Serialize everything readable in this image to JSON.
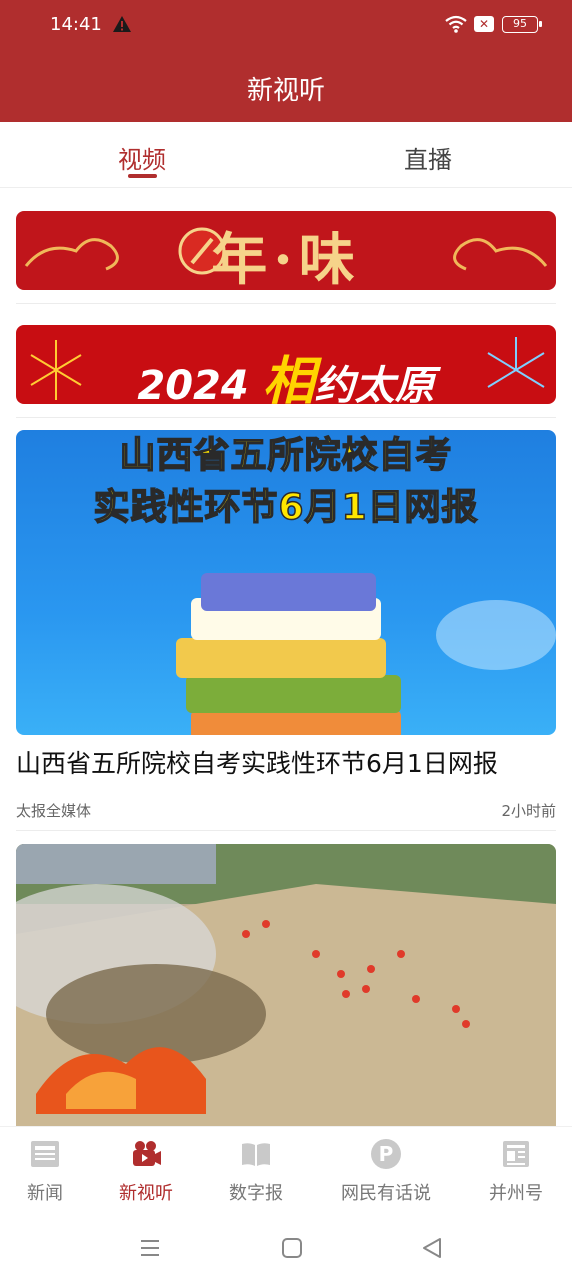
{
  "status_bar": {
    "time": "14:41",
    "battery": "95"
  },
  "header": {
    "title": "新视听"
  },
  "tabs": [
    {
      "label": "视频",
      "active": true
    },
    {
      "label": "直播",
      "active": false
    }
  ],
  "banners": [
    {
      "title": "年·味"
    },
    {
      "year": "2024",
      "accent": "相",
      "rest": "约太原"
    }
  ],
  "news": [
    {
      "thumb_line1": "山西省五所院校自考",
      "thumb_line2": "实践性环节6月1日网报",
      "title": "山西省五所院校自考实践性环节6月1日网报",
      "source": "太报全媒体",
      "time": "2小时前"
    },
    {
      "thumb_icon": "firefighting-drill-photo"
    }
  ],
  "bottom_nav": [
    {
      "label": "新闻",
      "icon": "newspaper-icon",
      "active": false
    },
    {
      "label": "新视听",
      "icon": "video-camera-icon",
      "active": true
    },
    {
      "label": "数字报",
      "icon": "open-book-icon",
      "active": false
    },
    {
      "label": "网民有话说",
      "icon": "p-badge-icon",
      "active": false
    },
    {
      "label": "并州号",
      "icon": "article-icon",
      "active": false
    }
  ],
  "colors": {
    "brand": "#b02e2e",
    "banner_red": "#c0151b",
    "gold": "#f6d38a",
    "yellow": "#ffd400"
  }
}
